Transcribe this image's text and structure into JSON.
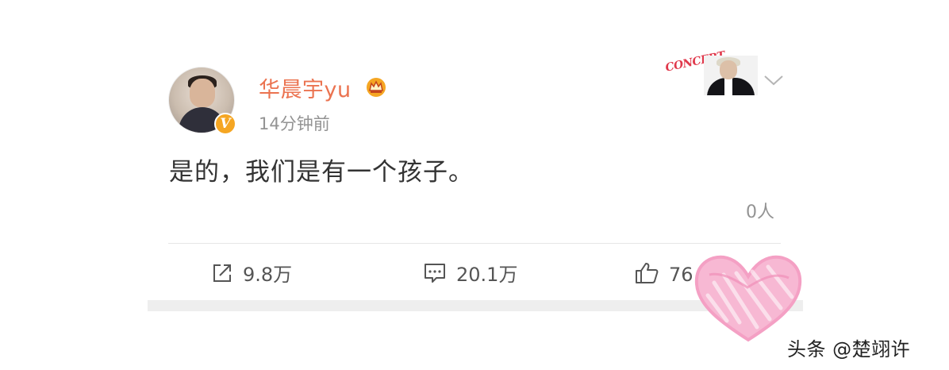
{
  "post": {
    "username": "华晨宇yu",
    "timestamp": "14分钟前",
    "text": "是的，我们是有一个孩子。",
    "likes_label": "0人"
  },
  "banner": {
    "text": "CONCERT"
  },
  "actions": {
    "repost_count": "9.8万",
    "comment_count": "20.1万",
    "like_count": "76.9万"
  },
  "watermark": {
    "text": "头条 @楚翊许"
  },
  "colors": {
    "username": "#eb7350",
    "timestamp": "#939393",
    "badge": "#f5a623",
    "heart": "#f6a9c8"
  },
  "icons": [
    "crown-icon",
    "verified-badge-icon",
    "chevron-down-icon",
    "repost-icon",
    "comment-icon",
    "like-icon",
    "heart-sticker-icon"
  ]
}
